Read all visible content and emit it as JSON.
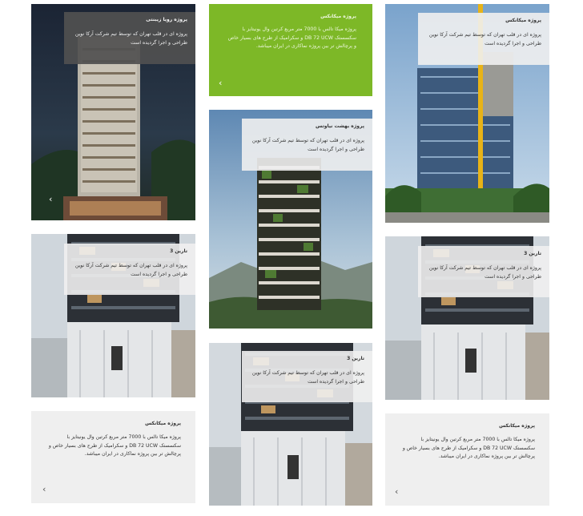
{
  "cards": [
    {
      "title": "پروژه رویا زیبنتی",
      "desc": "پروژه ای در قلب تهران که توسط تیم شرکت آرکا نوین طراحی و اجرا گردیده است"
    },
    {
      "title": "پروژه میکانکس",
      "desc": "پروژه میکا تالس با 7000 متر مربع کرتین وال یونیتایز با سکسستک DB 72 UCW و سکرامیک از طرح های بسیار خاص و پرچالش تر بین پروژه نماکاری در ایران میباشد."
    },
    {
      "title": "پروژه میکانکس",
      "desc": "پروژه ای در قلب تهران که توسط تیم شرکت آرکا نوین طراحی و اجرا گردیده است"
    },
    {
      "title": "پروژه بهشت نیاوتس",
      "desc": "پروژه ای در قلب تهران که توسط تیم شرکت آرکا نوین طراحی و اجرا گردیده است"
    },
    {
      "title": "تارین 3",
      "desc": "پروژه ای در قلب تهران که توسط تیم شرکت آرکا نوین طراحی و اجرا گردیده است"
    },
    {
      "title": "تارین 3",
      "desc": "پروژه ای در قلب تهران که توسط تیم شرکت آرکا نوین طراحی و اجرا گردیده است"
    },
    {
      "title": "تارین 3",
      "desc": "پروژه ای در قلب تهران که توسط تیم شرکت آرکا نوین طراحی و اجرا گردیده است"
    },
    {
      "title": "پروژه میکانکس",
      "desc": "پروژه میکا تالس با 7000 متر مربع کرتین وال یونیتایز با سکسستک DB 72 UCW و سکرامیک از طرح های بسیار خاص و پرچالش تر بین پروژه نماکاری در ایران میباشد."
    },
    {
      "title": "پروژه میکانکس",
      "desc": "پروژه میکا تالس با 7000 متر مربع کرتین وال یونیتایز با سکسستک DB 72 UCW و سکرامیک از طرح های بسیار خاص و پرچالش تر بین پروژه نماکاری در ایران میباشد."
    }
  ],
  "arrow_glyph": "‹",
  "colors": {
    "accent_green": "#7db827",
    "overlay_dark": "#505050",
    "overlay_light": "#f0f0f0"
  }
}
